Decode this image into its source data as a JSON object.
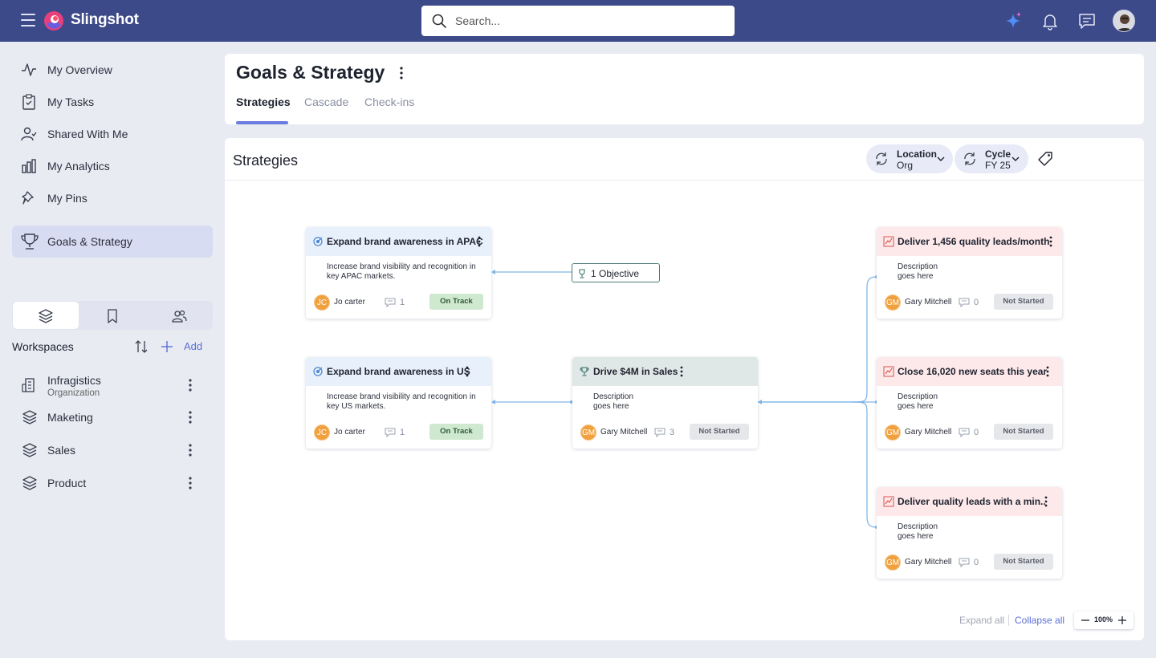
{
  "app": {
    "name": "Slingshot"
  },
  "search": {
    "placeholder": "Search..."
  },
  "sidebar": {
    "items": [
      {
        "label": "My Overview",
        "icon": "activity-icon"
      },
      {
        "label": "My Tasks",
        "icon": "clipboard-check-icon"
      },
      {
        "label": "Shared With Me",
        "icon": "user-check-icon"
      },
      {
        "label": "My Analytics",
        "icon": "bar-chart-icon"
      },
      {
        "label": "My Pins",
        "icon": "pin-icon"
      },
      {
        "label": "Goals & Strategy",
        "icon": "trophy-icon",
        "active": true
      }
    ],
    "workspaces_title": "Workspaces",
    "add_label": "Add",
    "workspaces": [
      {
        "label": "Infragistics",
        "sub": "Organization",
        "icon": "building-icon"
      },
      {
        "label": "Maketing",
        "icon": "layers-icon"
      },
      {
        "label": "Sales",
        "icon": "layers-icon"
      },
      {
        "label": "Product",
        "icon": "layers-icon"
      }
    ]
  },
  "header": {
    "title": "Goals & Strategy",
    "tabs": [
      {
        "label": "Strategies",
        "active": true
      },
      {
        "label": "Cascade"
      },
      {
        "label": "Check-ins"
      }
    ]
  },
  "panel": {
    "title": "Strategies",
    "filters": [
      {
        "label": "Location",
        "value": "Org"
      },
      {
        "label": "Cycle",
        "value": "FY 25"
      }
    ],
    "objective_chip": "1 Objective",
    "nodes": [
      {
        "title": "Expand brand awareness in APAC",
        "desc": "Increase brand visibility and recognition in key APAC markets.",
        "initials": "JC",
        "owner": "Jo carter",
        "count": "1",
        "status": "On Track"
      },
      {
        "title": "Expand brand awareness in US",
        "desc": "Increase brand visibility and recognition in key US markets.",
        "initials": "JC",
        "owner": "Jo carter",
        "count": "1",
        "status": "On Track"
      },
      {
        "title": "Drive $4M in Sales",
        "desc": "Description goes here",
        "initials": "GM",
        "owner": "Gary Mitchell",
        "count": "3",
        "status": "Not Started"
      },
      {
        "title": "Deliver 1,456 quality leads/month",
        "desc": "Description goes here",
        "initials": "GM",
        "owner": "Gary Mitchell",
        "count": "0",
        "status": "Not Started"
      },
      {
        "title": "Close 16,020 new seats this year",
        "desc": "Description goes here",
        "initials": "GM",
        "owner": "Gary Mitchell",
        "count": "0",
        "status": "Not Started"
      },
      {
        "title": "Deliver quality leads with a min..",
        "desc": "Description goes here",
        "initials": "GM",
        "owner": "Gary Mitchell",
        "count": "0",
        "status": "Not Started"
      }
    ],
    "footer": {
      "expand_all": "Expand all",
      "collapse_all": "Collapse all",
      "zoom": "100%"
    }
  },
  "colors": {
    "topbar": "#3d4a8a",
    "accent": "#5b6fd6",
    "on_track": "#cfe8d0",
    "not_started": "#e6e7ea"
  }
}
